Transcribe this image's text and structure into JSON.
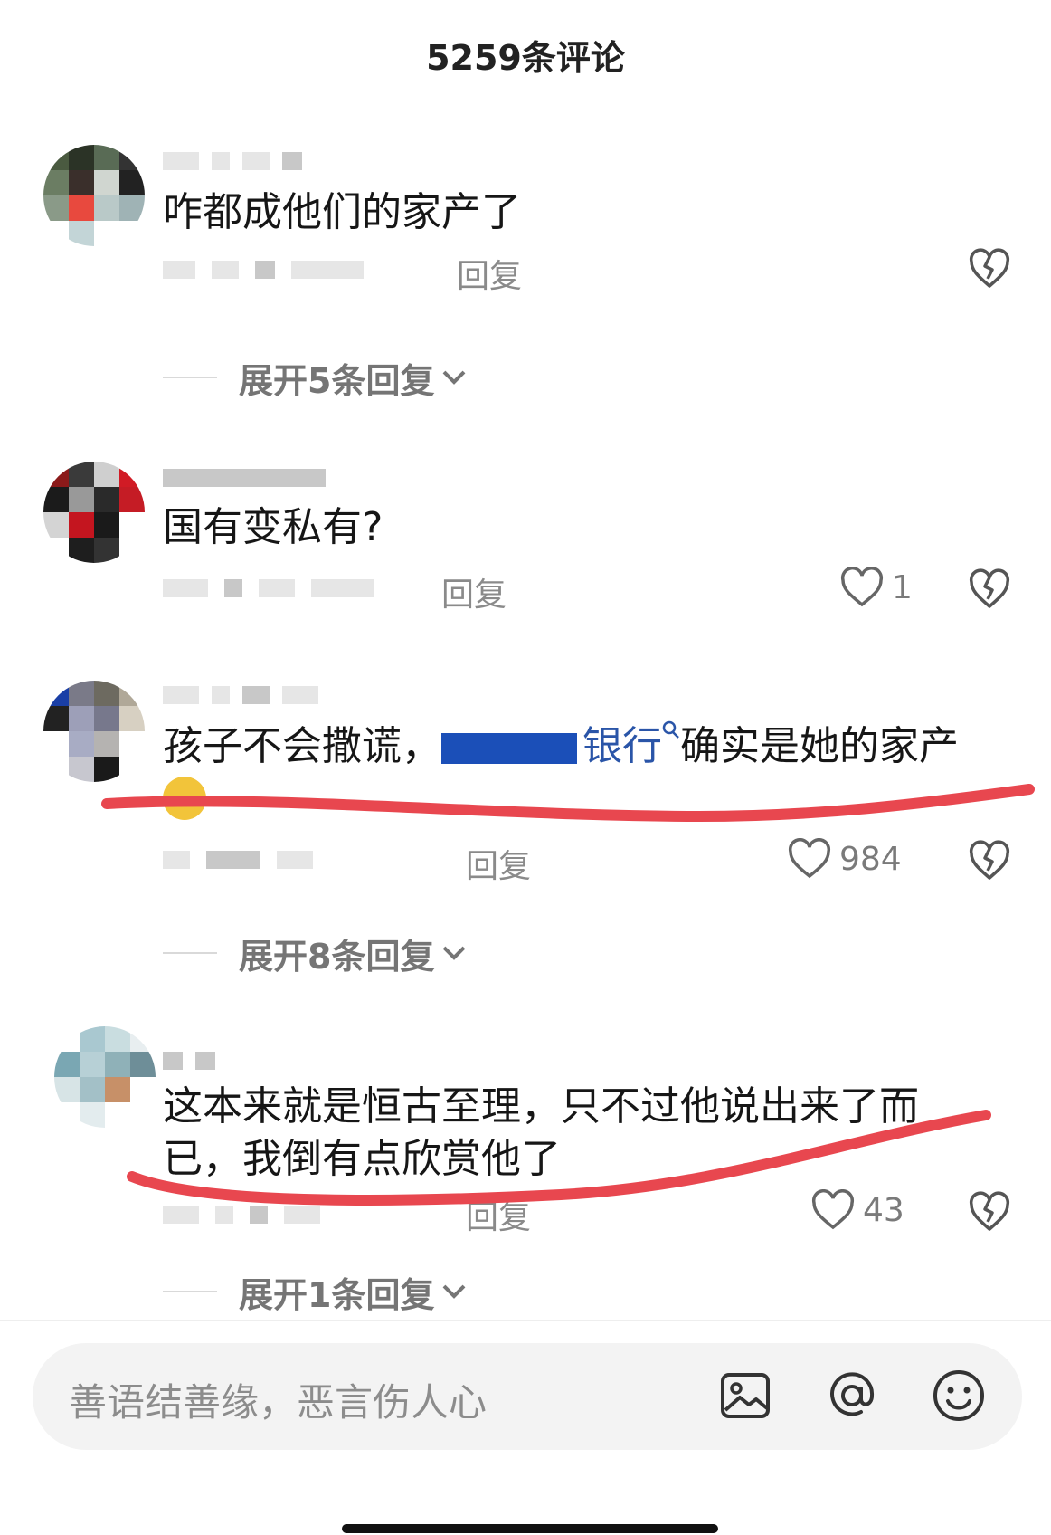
{
  "header": {
    "title": "5259条评论"
  },
  "comments": [
    {
      "text": "咋都成他们的家产了",
      "reply_label": "回复",
      "likes": "",
      "expand_label": "展开5条回复"
    },
    {
      "text": "国有变私有?",
      "reply_label": "回复",
      "likes": "1",
      "expand_label": ""
    },
    {
      "text_before": "孩子不会撒谎，",
      "link_text": "银行",
      "text_after": "确实是她的家产",
      "reply_label": "回复",
      "likes": "984",
      "expand_label": "展开8条回复"
    },
    {
      "text": "这本来就是恒古至理，只不过他说出来了而已，我倒有点欣赏他了",
      "reply_label": "回复",
      "likes": "43",
      "expand_label": "展开1条回复"
    }
  ],
  "input": {
    "placeholder": "善语结善缘，恶言伤人心",
    "image_icon": "image-icon",
    "mention_icon": "at-icon",
    "emoji_icon": "emoji-icon"
  },
  "colors": {
    "annotation_red": "#e8474f",
    "link_blue": "#2a55a8"
  }
}
